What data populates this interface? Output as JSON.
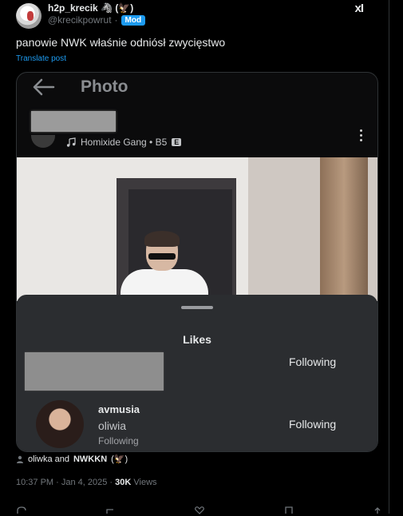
{
  "author": {
    "display_name": "h2p_krecik 🦓 (🦅)",
    "handle": "@krecikpowrut",
    "separator": "·",
    "badge": "Mod"
  },
  "header_icons": {
    "xai": "xI",
    "more": "···"
  },
  "tweet": {
    "text": "panowie NWK właśnie odniósł zwycięstwo",
    "translate_label": "Translate post"
  },
  "embedded": {
    "screen_title": "Photo",
    "music_label": "Homixide Gang • B5",
    "explicit_badge": "E",
    "sheet": {
      "title": "Likes",
      "rows": [
        {
          "status_button": "Following"
        },
        {
          "username": "avmusia",
          "display_name": "oliwia",
          "status": "Following",
          "status_button": "Following"
        }
      ]
    }
  },
  "likers": {
    "prefix": "oliwka and",
    "name": "NWKKN",
    "suffix": "(🦅)"
  },
  "meta": {
    "time": "10:37 PM · Jan 4, 2025 ·",
    "views_count": "30K",
    "views_label": "Views"
  },
  "colors": {
    "accent": "#1d9bf0",
    "background": "#000000",
    "sheet": "#2b2d30"
  }
}
